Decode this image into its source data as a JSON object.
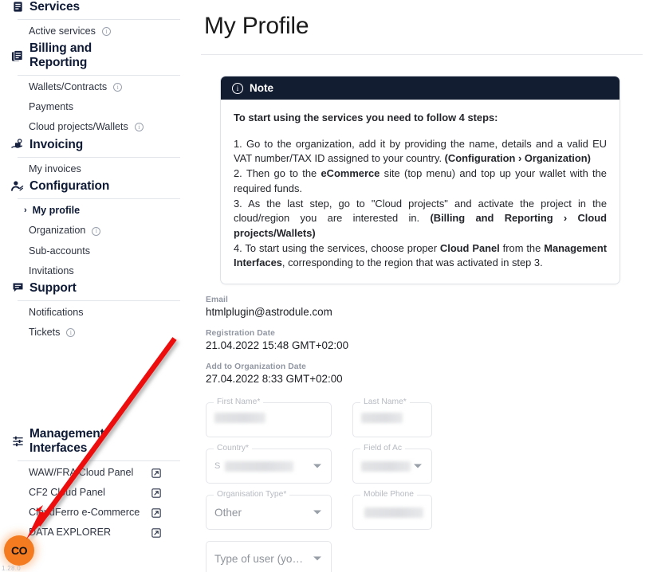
{
  "sidebar": {
    "groups": [
      {
        "title": "Services",
        "icon": "list-document-icon",
        "items": [
          {
            "label": "Active services",
            "info": true,
            "ext": false,
            "active": false
          }
        ]
      },
      {
        "title": "Billing and Reporting",
        "icon": "billing-document-icon",
        "items": [
          {
            "label": "Wallets/Contracts",
            "info": true,
            "ext": false,
            "active": false
          },
          {
            "label": "Payments",
            "info": false,
            "ext": false,
            "active": false
          },
          {
            "label": "Cloud projects/Wallets",
            "info": true,
            "ext": false,
            "active": false
          }
        ]
      },
      {
        "title": "Invoicing",
        "icon": "hand-invoice-icon",
        "items": [
          {
            "label": "My invoices",
            "info": false,
            "ext": false,
            "active": false
          }
        ]
      },
      {
        "title": "Configuration",
        "icon": "user-gear-icon",
        "items": [
          {
            "label": "My profile",
            "info": false,
            "ext": false,
            "active": true
          },
          {
            "label": "Organization",
            "info": true,
            "ext": false,
            "active": false
          },
          {
            "label": "Sub-accounts",
            "info": false,
            "ext": false,
            "active": false
          },
          {
            "label": "Invitations",
            "info": false,
            "ext": false,
            "active": false
          }
        ]
      },
      {
        "title": "Support",
        "icon": "chat-support-icon",
        "items": [
          {
            "label": "Notifications",
            "info": false,
            "ext": false,
            "active": false
          },
          {
            "label": "Tickets",
            "info": true,
            "ext": false,
            "active": false
          }
        ]
      },
      {
        "title": "Management Interfaces",
        "icon": "sliders-icon",
        "items": [
          {
            "label": "WAW/FRA Cloud Panel",
            "info": false,
            "ext": true,
            "active": false
          },
          {
            "label": "CF2 Cloud Panel",
            "info": false,
            "ext": true,
            "active": false
          },
          {
            "label": "CloudFerro e-Commerce",
            "info": false,
            "ext": true,
            "active": false
          },
          {
            "label": "DATA EXPLORER",
            "info": false,
            "ext": true,
            "active": false
          }
        ]
      }
    ],
    "avatar_initials": "CO",
    "version": "1.28.0"
  },
  "main": {
    "page_title": "My Profile",
    "note": {
      "header": "Note",
      "header_icon": "info-circle-icon",
      "lead": "To start using the services you need to follow 4 steps:",
      "steps_html": "1. Go to the organization, add it by providing the name, details and a valid EU VAT number/TAX ID assigned to your country. <b>(Configuration &rsaquo; Organization)</b><br>2. Then go to the <b>eCommerce</b> site (top menu) and top up your wallet with the required funds.<br>3. As the last step, go to \"Cloud projects\" and activate the project in the cloud/region you are interested in. <b>(Billing and Reporting &rsaquo; Cloud projects/Wallets)</b><br>4. To start using the services, choose proper <b>Cloud Panel</b> from the <b>Management Interfaces</b>, corresponding to the region that was activated in step 3."
    },
    "details": [
      {
        "label": "Email",
        "value": "htmlplugin@astrodule.com"
      },
      {
        "label": "Registration Date",
        "value": "21.04.2022 15:48 GMT+02:00"
      },
      {
        "label": "Add to Organization Date",
        "value": "27.04.2022 8:33 GMT+02:00"
      }
    ],
    "form": {
      "first_name": {
        "label": "First Name*",
        "value": "",
        "redacted": true
      },
      "last_name": {
        "label": "Last Name*",
        "value": "",
        "redacted": true
      },
      "country": {
        "label": "Country*",
        "value": "",
        "redacted": true
      },
      "field_of_activity": {
        "label": "Field of Ac",
        "value": "",
        "redacted": true
      },
      "organisation_type": {
        "label": "Organisation Type*",
        "value": "Other",
        "redacted": false
      },
      "mobile_phone": {
        "label": "Mobile Phone",
        "value": "",
        "redacted": true
      },
      "type_of_user": {
        "label": "",
        "value": "Type of user (yo…",
        "redacted": false
      }
    }
  },
  "annotation": {
    "arrow_color": "#ee1111"
  },
  "colors": {
    "note_header_bg": "#131d32",
    "accent_orange": "#f47b20",
    "text_dark": "#0e1a35",
    "muted": "#9096a1"
  }
}
